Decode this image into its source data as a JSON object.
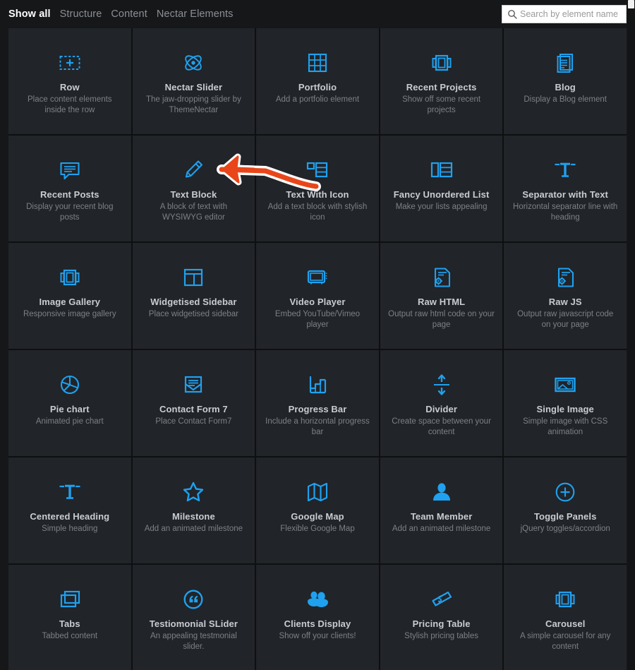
{
  "topbar": {
    "tabs": [
      {
        "label": "Show all",
        "active": true
      },
      {
        "label": "Structure",
        "active": false
      },
      {
        "label": "Content",
        "active": false
      },
      {
        "label": "Nectar Elements",
        "active": false
      }
    ],
    "search": {
      "placeholder": "Search by element name",
      "value": "",
      "icon": "search-icon"
    }
  },
  "annotation": {
    "type": "hand-drawn-arrow",
    "direction": "left",
    "color": "#e8461a",
    "outline_color": "#ffffff",
    "points_to": "Text Block"
  },
  "colors": {
    "accent": "#1fa1ef",
    "page_background": "#161719",
    "cell_background": "#212429",
    "grid_line": "#0e0f10",
    "title_text": "#c9ccd1",
    "desc_text": "#7d8086",
    "annotation": "#e8461a"
  },
  "grid": {
    "columns": 5,
    "items": [
      {
        "title": "Row",
        "desc": "Place content elements inside the row",
        "icon": "dashed-box-plus-icon"
      },
      {
        "title": "Nectar Slider",
        "desc": "The jaw-dropping slider by ThemeNectar",
        "icon": "atom-icon"
      },
      {
        "title": "Portfolio",
        "desc": "Add a portfolio element",
        "icon": "grid-3x3-icon"
      },
      {
        "title": "Recent Projects",
        "desc": "Show off some recent projects",
        "icon": "carousel-frame-icon"
      },
      {
        "title": "Blog",
        "desc": "Display a Blog element",
        "icon": "stacked-documents-icon"
      },
      {
        "title": "Recent Posts",
        "desc": "Display your recent blog posts",
        "icon": "speech-bubble-lines-icon"
      },
      {
        "title": "Text Block",
        "desc": "A block of text with WYSIWYG editor",
        "icon": "pencil-icon"
      },
      {
        "title": "Text With Icon",
        "desc": "Add a text block with stylish icon",
        "icon": "icon-with-list-icon"
      },
      {
        "title": "Fancy Unordered List",
        "desc": "Make your lists appealing",
        "icon": "list-panels-icon"
      },
      {
        "title": "Separator with Text",
        "desc": "Horizontal separator line with heading",
        "icon": "t-separator-icon"
      },
      {
        "title": "Image Gallery",
        "desc": "Responsive image gallery",
        "icon": "carousel-frame-icon"
      },
      {
        "title": "Widgetised Sidebar",
        "desc": "Place widgetised sidebar",
        "icon": "sidebar-layout-icon"
      },
      {
        "title": "Video Player",
        "desc": "Embed YouTube/Vimeo player",
        "icon": "tv-monitor-icon"
      },
      {
        "title": "Raw HTML",
        "desc": "Output raw html code on your page",
        "icon": "code-gear-page-icon"
      },
      {
        "title": "Raw JS",
        "desc": "Output raw javascript code on your page",
        "icon": "code-gear-page-icon"
      },
      {
        "title": "Pie chart",
        "desc": "Animated pie chart",
        "icon": "pie-chart-icon"
      },
      {
        "title": "Contact Form 7",
        "desc": "Place Contact Form7",
        "icon": "envelope-icon"
      },
      {
        "title": "Progress Bar",
        "desc": "Include a horizontal progress bar",
        "icon": "stairs-bar-icon"
      },
      {
        "title": "Divider",
        "desc": "Create space between your content",
        "icon": "up-down-arrows-line-icon"
      },
      {
        "title": "Single Image",
        "desc": "Simple image with CSS animation",
        "icon": "picture-frame-icon"
      },
      {
        "title": "Centered Heading",
        "desc": "Simple heading",
        "icon": "t-separator-icon"
      },
      {
        "title": "Milestone",
        "desc": "Add an animated milestone",
        "icon": "star-outline-icon"
      },
      {
        "title": "Google Map",
        "desc": "Flexible Google Map",
        "icon": "folded-map-icon"
      },
      {
        "title": "Team Member",
        "desc": "Add an animated milestone",
        "icon": "person-filled-icon"
      },
      {
        "title": "Toggle Panels",
        "desc": "jQuery toggles/accordion",
        "icon": "circle-plus-icon"
      },
      {
        "title": "Tabs",
        "desc": "Tabbed content",
        "icon": "stacked-windows-icon"
      },
      {
        "title": "Testiomonial SLider",
        "desc": "An appealing testmonial slider.",
        "icon": "quote-circle-icon"
      },
      {
        "title": "Clients Display",
        "desc": "Show off your clients!",
        "icon": "two-people-icon"
      },
      {
        "title": "Pricing Table",
        "desc": "Stylish pricing tables",
        "icon": "money-note-icon"
      },
      {
        "title": "Carousel",
        "desc": "A simple carousel for any content",
        "icon": "carousel-frame-icon"
      }
    ]
  }
}
